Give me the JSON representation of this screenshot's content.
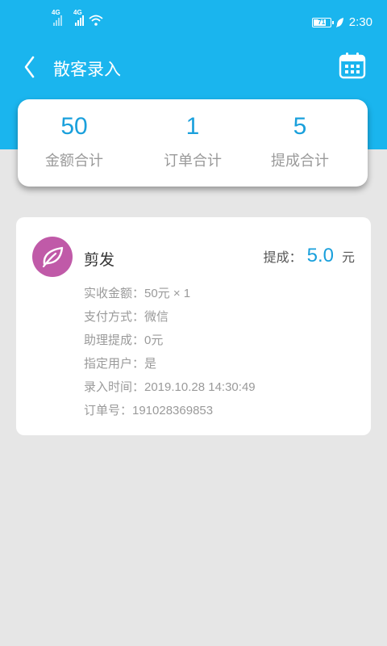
{
  "status_bar": {
    "signal1_label": "4G",
    "signal2_label": "4G",
    "battery": "71",
    "time": "2:30"
  },
  "nav": {
    "title": "散客录入",
    "back_icon": "chevron-left-icon",
    "calendar_icon": "calendar-icon"
  },
  "summary": [
    {
      "value": "50",
      "label": "金额合计"
    },
    {
      "value": "1",
      "label": "订单合计"
    },
    {
      "value": "5",
      "label": "提成合计"
    }
  ],
  "order": {
    "service_name": "剪发",
    "avatar_icon": "leaf-icon",
    "avatar_color": "#c05aa8",
    "commission_label": "提成：",
    "commission_value": "5.0",
    "commission_unit": "元",
    "details": [
      "实收金额：50元 × 1",
      "支付方式：微信",
      "助理提成：0元",
      "指定用户：是",
      "录入时间：2019.10.28 14:30:49",
      "订单号：191028369853"
    ]
  },
  "colors": {
    "accent": "#1ab5ee",
    "value_blue": "#1aa0dc",
    "background": "#e6e6e6"
  }
}
